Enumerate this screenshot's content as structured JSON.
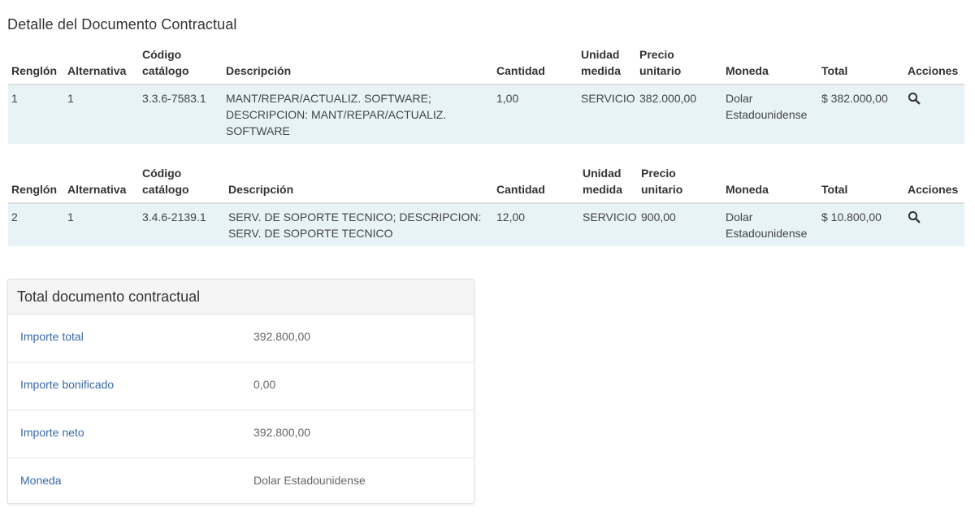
{
  "page_title": "Detalle del Documento Contractual",
  "columns": {
    "renglon": "Renglón",
    "alternativa": "Alternativa",
    "codigo_1": "Código",
    "codigo_2": "catálogo",
    "descripcion": "Descripción",
    "cantidad": "Cantidad",
    "unidad_1": "Unidad",
    "unidad_2": "medida",
    "precio_1": "Precio",
    "precio_2": "unitario",
    "moneda": "Moneda",
    "total": "Total",
    "acciones": "Acciones"
  },
  "items": [
    {
      "renglon": "1",
      "alternativa": "1",
      "codigo": "3.3.6-7583.1",
      "descripcion": "MANT/REPAR/ACTUALIZ. SOFTWARE; DESCRIPCION: MANT/REPAR/ACTUALIZ. SOFTWARE",
      "cantidad": "1,00",
      "unidad": "SERVICIO",
      "precio": "382.000,00",
      "moneda": "Dolar Estadounidense",
      "total": "$ 382.000,00",
      "action_icon": "search-icon"
    },
    {
      "renglon": "2",
      "alternativa": "1",
      "codigo": "3.4.6-2139.1",
      "descripcion": "SERV. DE SOPORTE TECNICO; DESCRIPCION: SERV. DE SOPORTE TECNICO",
      "cantidad": "12,00",
      "unidad": "SERVICIO",
      "precio": "900,00",
      "moneda": "Dolar Estadounidense",
      "total": "$ 10.800,00",
      "action_icon": "search-icon"
    }
  ],
  "totals_panel": {
    "title": "Total documento contractual",
    "rows": [
      {
        "label": "Importe total",
        "value": "392.800,00"
      },
      {
        "label": "Importe bonificado",
        "value": "0,00"
      },
      {
        "label": "Importe neto",
        "value": "392.800,00"
      },
      {
        "label": "Moneda",
        "value": "Dolar Estadounidense"
      }
    ]
  },
  "colors": {
    "row_background": "#e8f3f8",
    "label_link": "#3a6aa8",
    "panel_heading_bg": "#f5f5f5"
  }
}
